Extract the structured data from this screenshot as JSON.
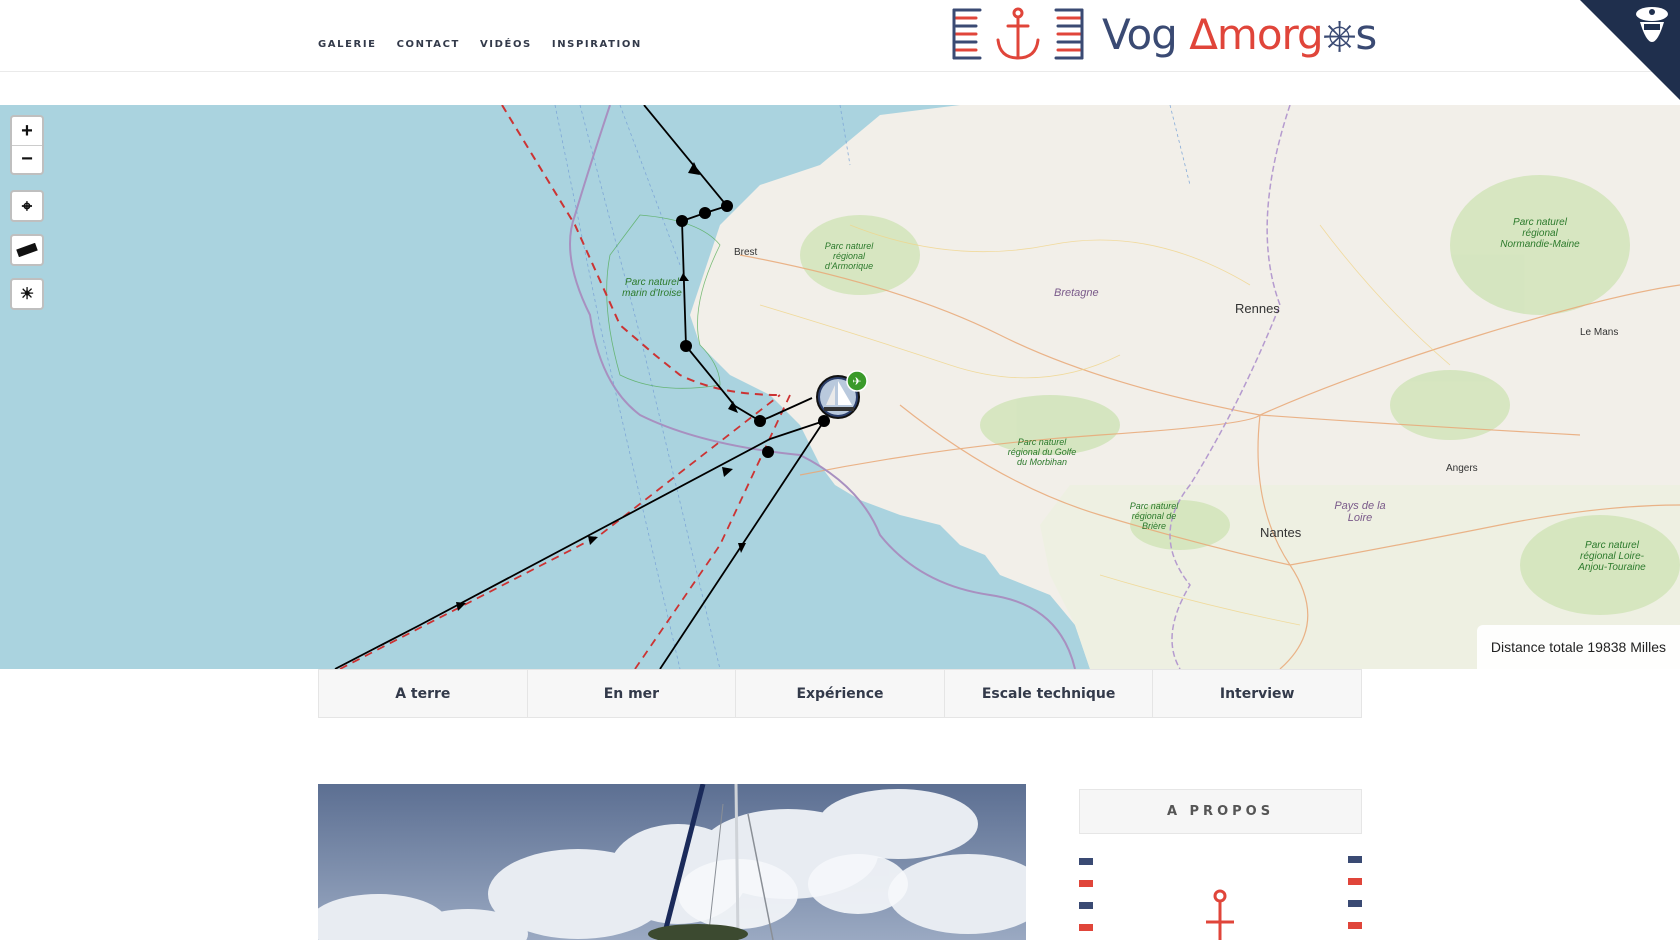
{
  "nav": {
    "items": [
      "GALERIE",
      "CONTACT",
      "VIDÉOS",
      "INSPIRATION"
    ]
  },
  "logo": {
    "text_part1": "Vog ",
    "text_part2": "morg",
    "text_part3": "s"
  },
  "map": {
    "controls": {
      "zoom_in": "+",
      "zoom_out": "−"
    },
    "distance": "Distance totale 19838 Milles",
    "labels": {
      "brest": "Brest",
      "rennes": "Rennes",
      "le_mans": "Le Mans",
      "angers": "Angers",
      "nantes": "Nantes",
      "bretagne": "Bretagne",
      "pays_loire": "Pays de la Loire",
      "parc_marin": "Parc naturel marin d'Iroise",
      "parc_armorique": "Parc naturel régional d'Armorique",
      "parc_golfe": "Parc naturel régional du Golfe du Morbihan",
      "parc_briere": "Parc naturel régional de Brière",
      "parc_normandie": "Parc naturel régional Normandie-Maine",
      "parc_loire": "Parc naturel régional Loire-Anjou-Touraine"
    }
  },
  "tabs": [
    "A terre",
    "En mer",
    "Expérience",
    "Escale technique",
    "Interview"
  ],
  "sidebar": {
    "apropos": "A PROPOS"
  },
  "colors": {
    "navy": "#3a4a73",
    "red": "#e0453a",
    "sea": "#aad3df",
    "land": "#f2efe9"
  }
}
